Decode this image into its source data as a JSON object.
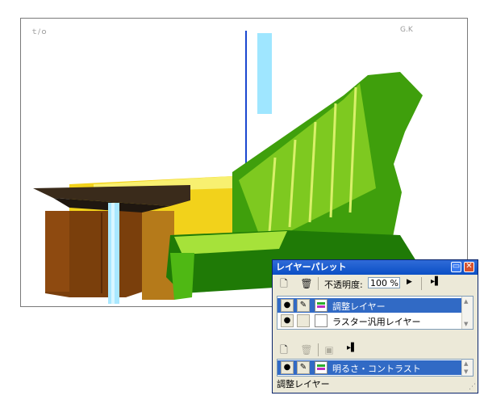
{
  "canvas": {
    "marks": [
      "ｔ/ｏ",
      "G.K"
    ]
  },
  "palette": {
    "title": "レイヤーパレット",
    "opacity_label": "不透明度:",
    "opacity_value": "100 %",
    "layers": [
      {
        "name": "調整レイヤー",
        "selected": true
      },
      {
        "name": "ラスター汎用レイヤー",
        "selected": false
      }
    ],
    "adjust_layers": [
      {
        "name": "明るさ・コントラスト",
        "selected": true
      }
    ],
    "status": "調整レイヤー"
  },
  "colors": {
    "titlebar": "#0b4fc5",
    "selection": "#316ac5",
    "window_bg": "#ece9d8"
  }
}
